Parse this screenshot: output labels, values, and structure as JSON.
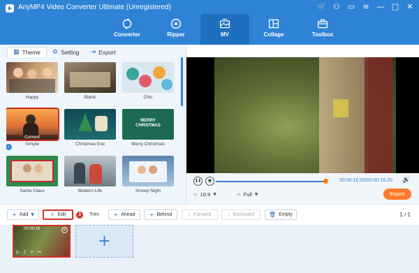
{
  "app": {
    "title": "AnyMP4 Video Converter Ultimate (Unregistered)"
  },
  "window_controls": [
    {
      "name": "cart-icon",
      "glyph": "🛒"
    },
    {
      "name": "account-icon",
      "glyph": "⚇"
    },
    {
      "name": "chat-icon",
      "glyph": "▭"
    },
    {
      "name": "menu-icon",
      "glyph": "≡"
    },
    {
      "name": "minimize-icon",
      "glyph": "—"
    },
    {
      "name": "maximize-icon",
      "glyph": "□"
    },
    {
      "name": "close-icon",
      "glyph": "✕"
    }
  ],
  "nav": [
    {
      "label": "Converter",
      "icon": "converter-icon"
    },
    {
      "label": "Ripper",
      "icon": "disc-icon"
    },
    {
      "label": "MV",
      "icon": "mv-icon",
      "active": true
    },
    {
      "label": "Collage",
      "icon": "collage-icon"
    },
    {
      "label": "Toolbox",
      "icon": "toolbox-icon"
    }
  ],
  "tabs": [
    {
      "label": "Theme",
      "icon": "grid-icon",
      "active": true
    },
    {
      "label": "Setting",
      "icon": "gear-icon"
    },
    {
      "label": "Export",
      "icon": "export-icon"
    }
  ],
  "themes": [
    {
      "label": "Happy"
    },
    {
      "label": "Blank"
    },
    {
      "label": "Chic"
    },
    {
      "label": "Simple",
      "selected": true,
      "tag": "Current"
    },
    {
      "label": "Christmas Eve"
    },
    {
      "label": "Merry Christmas",
      "overlay": "MERRY\nCHRISTMAS"
    },
    {
      "label": "Santa Claus"
    },
    {
      "label": "Modern Life"
    },
    {
      "label": "Snowy Night"
    }
  ],
  "player": {
    "timecode": "00:00:16.00/00:00:16.20",
    "progress": 0.98,
    "aspect_ratio": "16:9",
    "mode": "Full",
    "export_label": "Export"
  },
  "toolbar": {
    "add_label": "Add",
    "edit_label": "Edit",
    "step_badge": "3",
    "trim_label": "Trim",
    "ahead_label": "Ahead",
    "behind_label": "Behind",
    "forward_label": "Forward",
    "backward_label": "Backward",
    "empty_label": "Empty",
    "page_counter": "1 / 1"
  },
  "timeline": {
    "clip_time": "00:00:16",
    "add_symbol": "+"
  },
  "colors": {
    "accent": "#2f83d6",
    "highlight": "#d0302c",
    "export": "#ff7a2a"
  }
}
